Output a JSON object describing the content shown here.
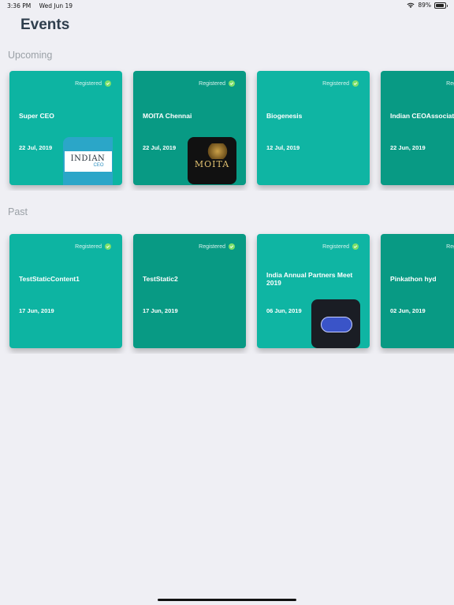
{
  "status": {
    "time": "3:36 PM",
    "date": "Wed Jun 19",
    "battery": "89%",
    "battery_level": 0.89
  },
  "title": "Events",
  "sections": {
    "upcoming": "Upcoming",
    "past": "Past"
  },
  "registered_label": "Registered",
  "upcoming": [
    {
      "title": "Super CEO",
      "date": "22 Jul, 2019",
      "registered": true,
      "thumb": "indian-ceo-logo"
    },
    {
      "title": "MOITA Chennai",
      "date": "22 Jul, 2019",
      "registered": true,
      "thumb": "moita-logo"
    },
    {
      "title": "Biogenesis",
      "date": "12 Jul, 2019",
      "registered": true
    },
    {
      "title": "Indian CEOAssociation",
      "date": "22 Jun, 2019",
      "registered": true
    }
  ],
  "past": [
    {
      "title": "TestStaticContent1",
      "date": "17 Jun, 2019",
      "registered": true
    },
    {
      "title": "TestStatic2",
      "date": "17 Jun, 2019",
      "registered": true
    },
    {
      "title": "India Annual Partners Meet 2019",
      "date": "06 Jun, 2019",
      "registered": true,
      "thumb": "partners-meet-logo"
    },
    {
      "title": "Pinkathon hyd",
      "date": "02 Jun, 2019",
      "registered": true
    }
  ],
  "logos": {
    "indian_ceo_a": "INDIAN",
    "indian_ceo_b": "CEO",
    "moita": "MOITA"
  },
  "colors": {
    "teal_light": "#0db4a2",
    "teal_dark": "#089a84",
    "check": "#7fe06a",
    "background": "#efeff4"
  }
}
